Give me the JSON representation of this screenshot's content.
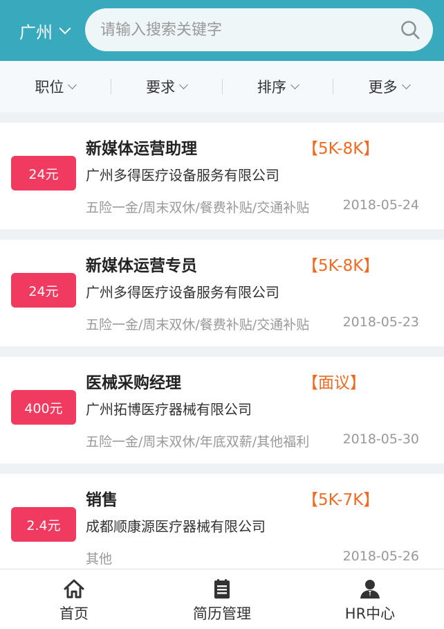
{
  "header": {
    "city": "广州",
    "search_placeholder": "请输入搜索关键字"
  },
  "filters": [
    {
      "label": "职位"
    },
    {
      "label": "要求"
    },
    {
      "label": "排序"
    },
    {
      "label": "更多"
    }
  ],
  "jobs": [
    {
      "reward": "24元",
      "title": "新媒体运营助理",
      "salary": "【5K-8K】",
      "company": "广州多得医疗设备服务有限公司",
      "benefits": "五险一金/周末双休/餐费补贴/交通补贴",
      "date": "2018-05-24"
    },
    {
      "reward": "24元",
      "title": "新媒体运营专员",
      "salary": "【5K-8K】",
      "company": "广州多得医疗设备服务有限公司",
      "benefits": "五险一金/周末双休/餐费补贴/交通补贴",
      "date": "2018-05-23"
    },
    {
      "reward": "400元",
      "title": "医械采购经理",
      "salary": "【面议】",
      "company": "广州拓博医疗器械有限公司",
      "benefits": "五险一金/周末双休/年底双薪/其他福利",
      "date": "2018-05-30"
    },
    {
      "reward": "2.4元",
      "title": "销售",
      "salary": "【5K-7K】",
      "company": "成都顺康源医疗器械有限公司",
      "benefits": "其他",
      "date": "2018-05-26"
    }
  ],
  "bottom_nav": [
    {
      "label": "首页",
      "icon": "home-icon"
    },
    {
      "label": "简历管理",
      "icon": "resume-icon"
    },
    {
      "label": "HR中心",
      "icon": "hr-user-icon"
    }
  ],
  "colors": {
    "header_bg": "#39a9bd",
    "badge": "#f03a5f",
    "salary": "#f06a22"
  }
}
